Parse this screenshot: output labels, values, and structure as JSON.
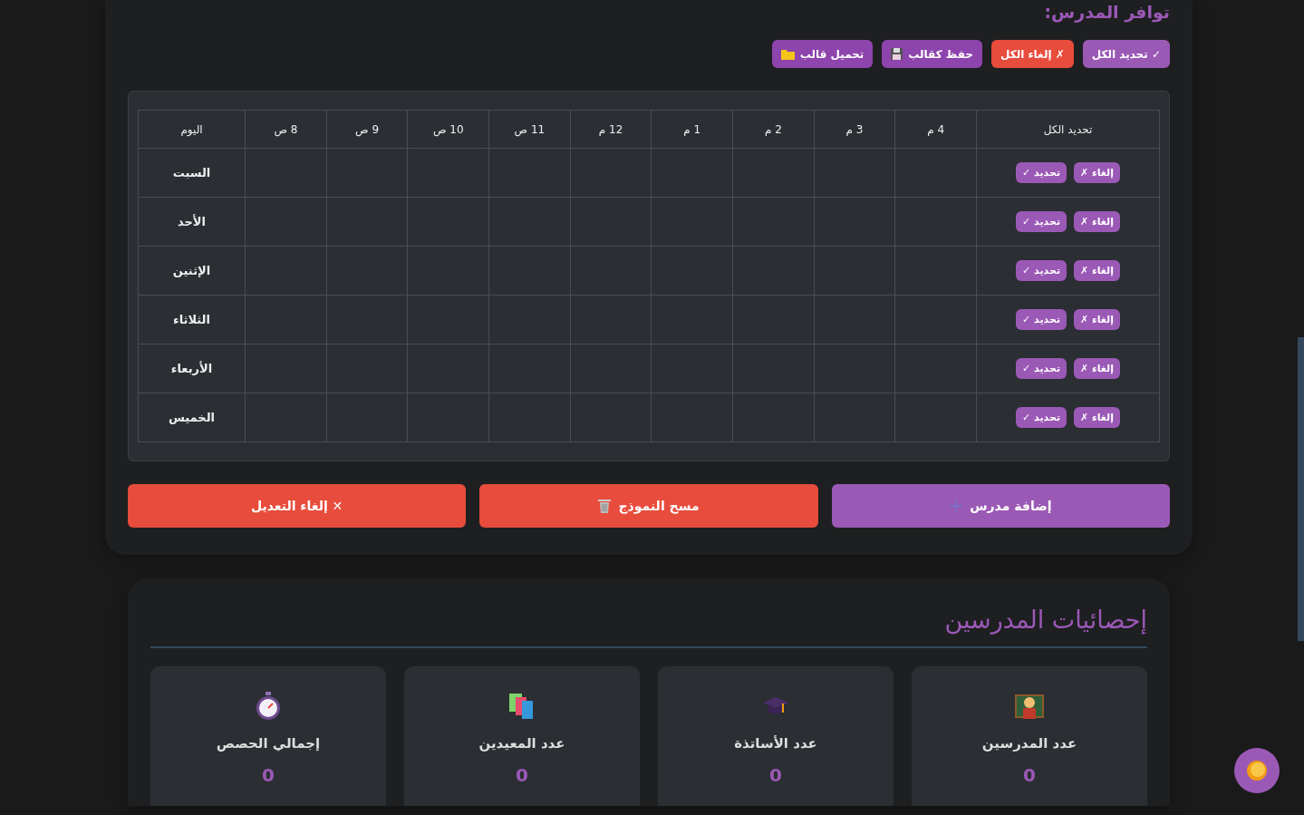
{
  "availability": {
    "title": "توافر المدرس:",
    "toolbar": [
      {
        "label": "✓ تحديد الكل",
        "kind": "primary"
      },
      {
        "label": "✗ إلغاء الكل",
        "kind": "danger"
      },
      {
        "label": "حفظ كقالب",
        "kind": "primary"
      },
      {
        "label": "تحميل قالب",
        "kind": "primary"
      }
    ],
    "table": {
      "columns": [
        "تحديد الكل",
        "4 م",
        "3 م",
        "2 م",
        "1 م",
        "12 م",
        "11 ص",
        "10 ص",
        "9 ص",
        "8 ص",
        "اليوم"
      ],
      "rows": [
        {
          "actions": [
            "إلغاء ✗",
            "تحديد ✓"
          ],
          "day": "السبت"
        },
        {
          "actions": [
            "إلغاء ✗",
            "تحديد ✓"
          ],
          "day": "الأحد"
        },
        {
          "actions": [
            "إلغاء ✗",
            "تحديد ✓"
          ],
          "day": "الإثنين"
        },
        {
          "actions": [
            "إلغاء ✗",
            "تحديد ✓"
          ],
          "day": "الثلاثاء"
        },
        {
          "actions": [
            "إلغاء ✗",
            "تحديد ✓"
          ],
          "day": "الأربعاء"
        },
        {
          "actions": [
            "إلغاء ✗",
            "تحديد ✓"
          ],
          "day": "الخميس"
        }
      ]
    },
    "form_buttons": [
      {
        "label": "إضافة مدرس",
        "kind": "primary"
      },
      {
        "label": "مسح النموذج",
        "kind": "danger"
      },
      {
        "label": "✕ إلغاء التعديل",
        "kind": "danger"
      }
    ]
  },
  "statistics": {
    "title": "إحصائيات المدرسين",
    "cards": [
      {
        "label": "عدد المدرسين",
        "value": "0"
      },
      {
        "label": "عدد الأساتذة",
        "value": "0"
      },
      {
        "label": "عدد المعيدين",
        "value": "0"
      },
      {
        "label": "إجمالي الحصص",
        "value": "0"
      }
    ]
  }
}
